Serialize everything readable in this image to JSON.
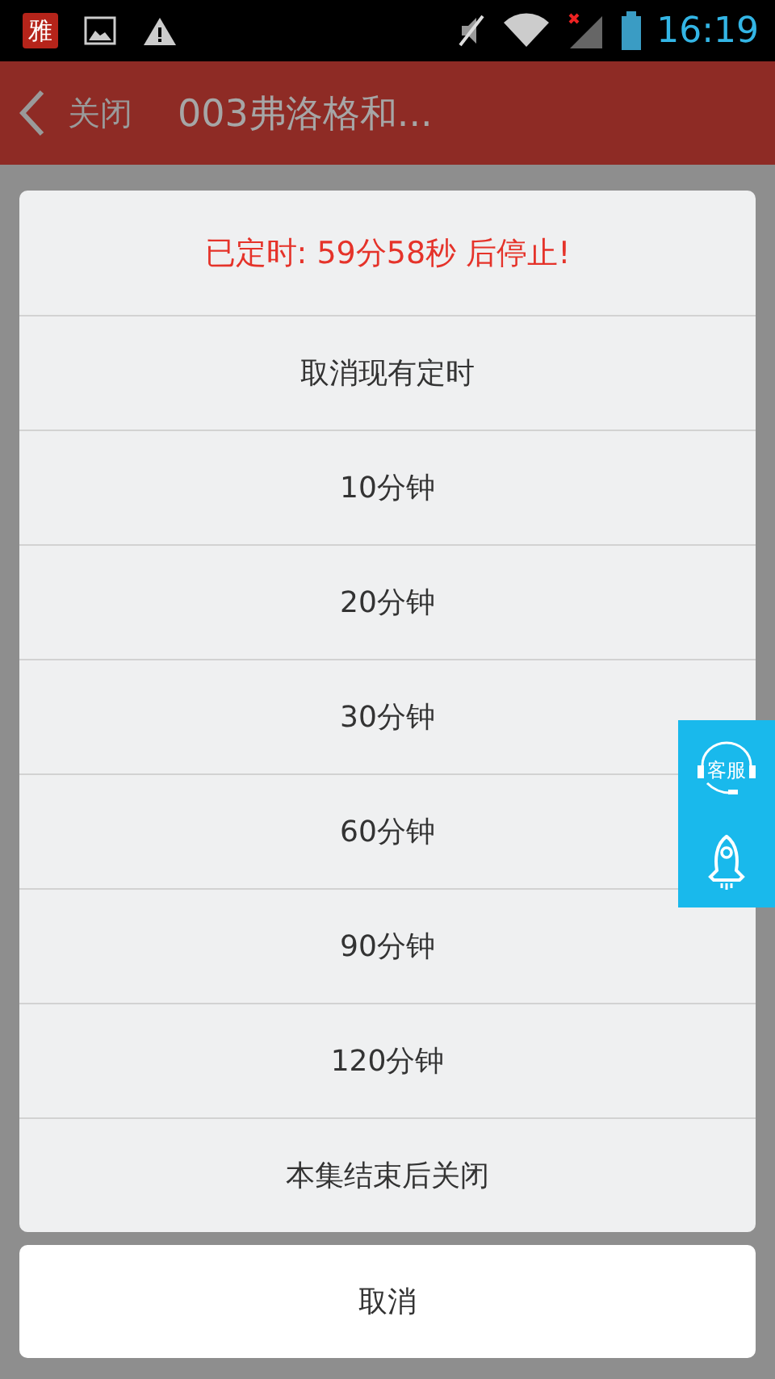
{
  "status_bar": {
    "app_badge": "雅",
    "time": "16:19"
  },
  "header": {
    "back_label": "关闭",
    "title": "003弗洛格和..."
  },
  "dialog": {
    "status": "已定时: 59分58秒 后停止!",
    "options": [
      "取消现有定时",
      "10分钟",
      "20分钟",
      "30分钟",
      "60分钟",
      "90分钟",
      "120分钟",
      "本集结束后关闭"
    ],
    "cancel": "取消"
  },
  "side_buttons": {
    "service_label": "客服"
  }
}
